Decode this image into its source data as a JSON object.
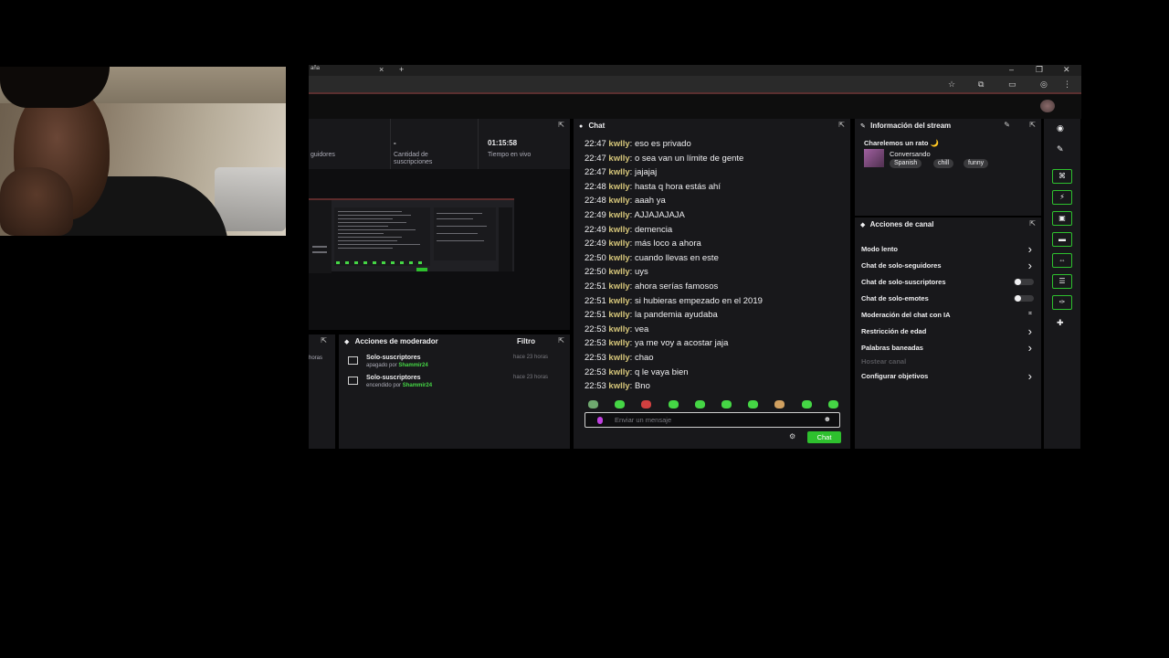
{
  "browser": {
    "tab_title": "aña",
    "tab_close": "×",
    "new_tab": "+",
    "window_controls": [
      "–",
      "❐",
      "✕"
    ]
  },
  "stats": {
    "followers_label": "guidores",
    "subs_value": "-",
    "subs_label": "Cantidad de suscripciones",
    "uptime_value": "01:15:58",
    "uptime_label": "Tiempo en vivo"
  },
  "mod_actions": {
    "title": "Acciones de moderador",
    "filter": "Filtro",
    "left_label": "horas",
    "items": [
      {
        "title": "Solo-suscriptores",
        "action": "apagado por",
        "user": "Shammir24",
        "time": "hace 23 horas"
      },
      {
        "title": "Solo-suscriptores",
        "action": "encendido por",
        "user": "Shammir24",
        "time": "hace 23 horas"
      }
    ]
  },
  "chat": {
    "title": "Chat",
    "messages": [
      {
        "time": "22:47",
        "user": "kwlly",
        "text": "eso es privado"
      },
      {
        "time": "22:47",
        "user": "kwlly",
        "text": "o sea van un límite de gente"
      },
      {
        "time": "22:47",
        "user": "kwlly",
        "text": "jajajaj"
      },
      {
        "time": "22:48",
        "user": "kwlly",
        "text": "hasta q hora estás ahí"
      },
      {
        "time": "22:48",
        "user": "kwlly",
        "text": "aaah ya"
      },
      {
        "time": "22:49",
        "user": "kwlly",
        "text": "AJJAJAJAJA"
      },
      {
        "time": "22:49",
        "user": "kwlly",
        "text": "demencia"
      },
      {
        "time": "22:49",
        "user": "kwlly",
        "text": "más loco a ahora"
      },
      {
        "time": "22:50",
        "user": "kwlly",
        "text": "cuando llevas en este"
      },
      {
        "time": "22:50",
        "user": "kwlly",
        "text": "uys"
      },
      {
        "time": "22:51",
        "user": "kwlly",
        "text": "ahora serías famosos"
      },
      {
        "time": "22:51",
        "user": "kwlly",
        "text": "si hubieras empezado en el 2019"
      },
      {
        "time": "22:51",
        "user": "kwlly",
        "text": "la pandemia ayudaba"
      },
      {
        "time": "22:53",
        "user": "kwlly",
        "text": "vea"
      },
      {
        "time": "22:53",
        "user": "kwlly",
        "text": "ya me voy a acostar jaja"
      },
      {
        "time": "22:53",
        "user": "kwlly",
        "text": "chao"
      },
      {
        "time": "22:53",
        "user": "kwlly",
        "text": "q le vaya bien"
      },
      {
        "time": "22:53",
        "user": "kwlly",
        "text": "Bno"
      }
    ],
    "placeholder": "Enviar un mensaje",
    "send_label": "Chat",
    "emote_colors": [
      "#6fa86f",
      "#45d645",
      "#d04040",
      "#45d645",
      "#45d645",
      "#45d645",
      "#45d645",
      "#d0a060",
      "#45d645",
      "#45d645"
    ]
  },
  "stream_info": {
    "title": "Información del stream",
    "stream_title": "Charelemos un rato 🌙",
    "category": "Conversando",
    "tags": [
      "Spanish",
      "chill",
      "funny"
    ]
  },
  "channel_actions": {
    "title": "Acciones de canal",
    "items": [
      {
        "label": "Modo lento",
        "control": "chevron"
      },
      {
        "label": "Chat de solo-seguidores",
        "control": "chevron"
      },
      {
        "label": "Chat de solo-suscriptores",
        "control": "toggle"
      },
      {
        "label": "Chat de solo-emotes",
        "control": "toggle"
      },
      {
        "label": "Moderación del chat con IA",
        "control": "graph"
      },
      {
        "label": "Restricción de edad",
        "control": "chevron"
      },
      {
        "label": "Palabras baneadas",
        "control": "chevron"
      },
      {
        "label": "Hostear canal",
        "control": "none"
      },
      {
        "label": "Configurar objetivos",
        "control": "chevron"
      }
    ]
  },
  "accent_color": "#2ec02e"
}
